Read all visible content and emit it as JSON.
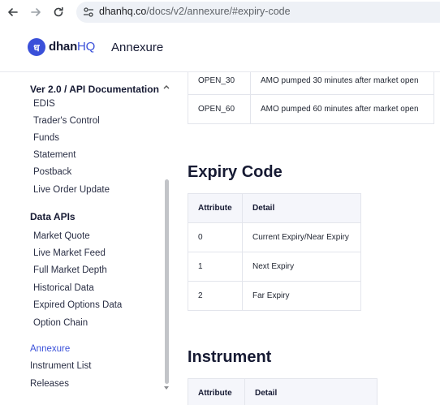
{
  "browser": {
    "url_host": "dhanhq.co",
    "url_path": "/docs/v2/annexure/#expiry-code"
  },
  "header": {
    "logo_symbol": "ध",
    "logo_name": "dhan",
    "logo_suffix": "HQ",
    "page_title": "Annexure"
  },
  "sidebar": {
    "section_api": "Ver 2.0 / API Documentation",
    "api_items": [
      "EDIS",
      "Trader's Control",
      "Funds",
      "Statement",
      "Postback",
      "Live Order Update"
    ],
    "section_data": "Data APIs",
    "data_items": [
      "Market Quote",
      "Live Market Feed",
      "Full Market Depth",
      "Historical Data",
      "Expired Options Data",
      "Option Chain"
    ],
    "bottom_items": [
      "Annexure",
      "Instrument List",
      "Releases"
    ],
    "active_item": "Annexure"
  },
  "amo_table": {
    "rows": [
      [
        "OPEN_30",
        "AMO pumped 30 minutes after market open"
      ],
      [
        "OPEN_60",
        "AMO pumped 60 minutes after market open"
      ]
    ]
  },
  "expiry": {
    "heading": "Expiry Code",
    "headers": [
      "Attribute",
      "Detail"
    ],
    "rows": [
      [
        "0",
        "Current Expiry/Near Expiry"
      ],
      [
        "1",
        "Next Expiry"
      ],
      [
        "2",
        "Far Expiry"
      ]
    ]
  },
  "instrument": {
    "heading": "Instrument",
    "headers": [
      "Attribute",
      "Detail"
    ]
  },
  "colors": {
    "accent": "#3a50d9",
    "heading": "#161a33",
    "table_header_bg": "#f5f6fb"
  }
}
